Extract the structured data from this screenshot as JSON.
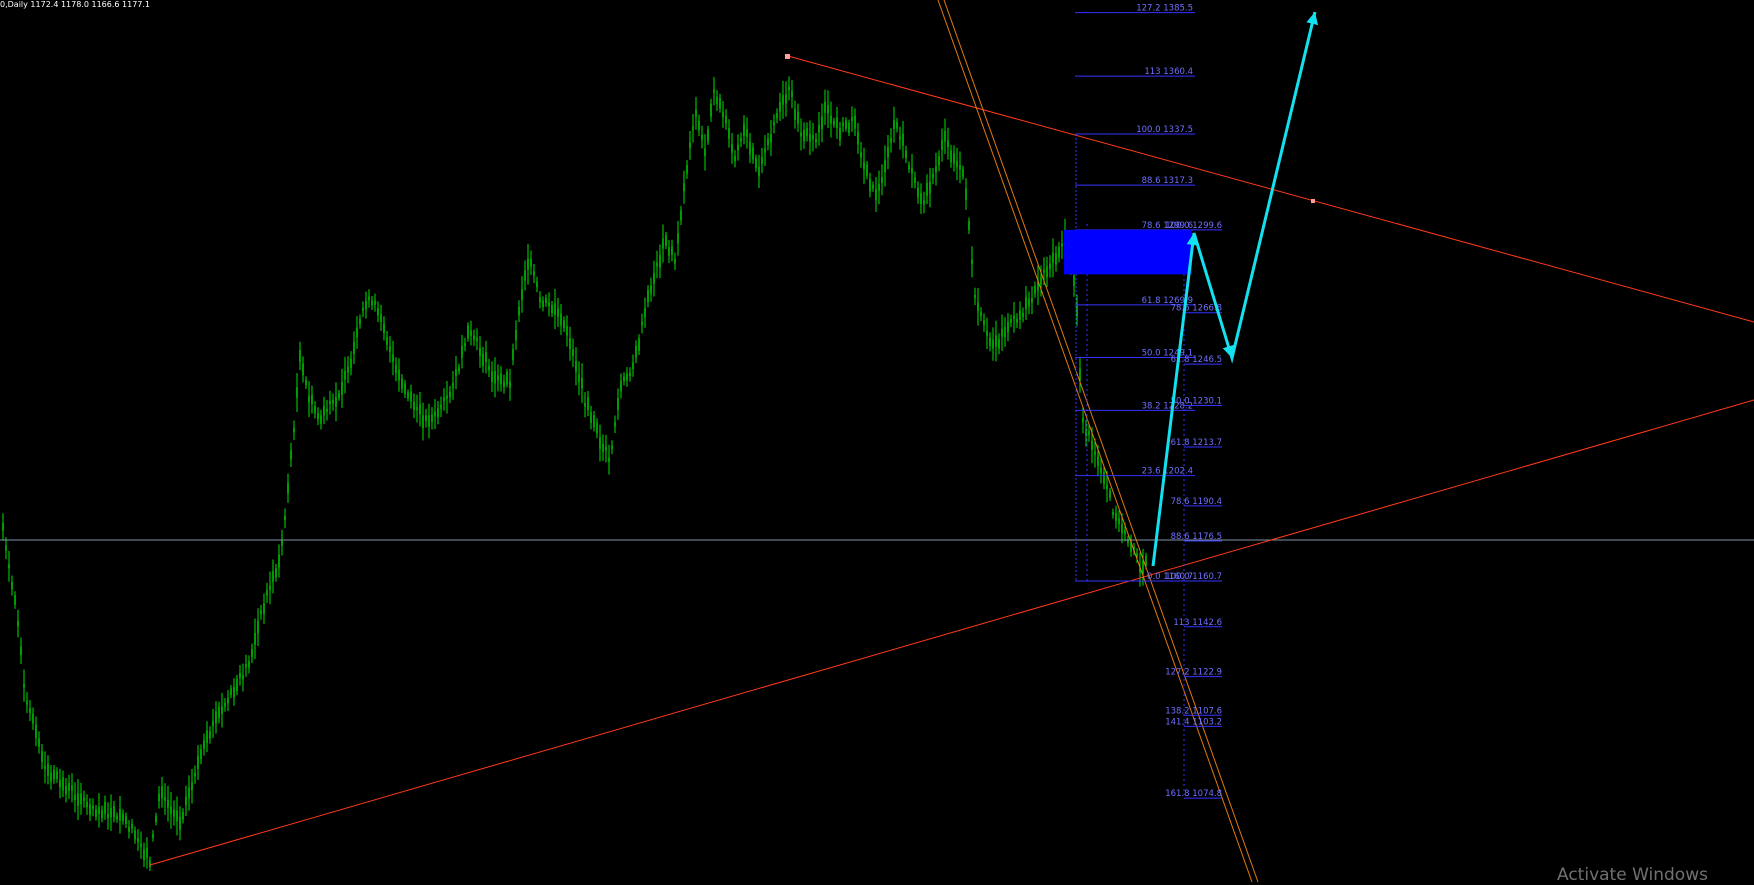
{
  "header": {
    "symbol_text": "0,Daily  1172.4 1178.0 1166.6 1177.1"
  },
  "watermark": "Activate Windows",
  "colors": {
    "background": "#000000",
    "candle": "#00e000",
    "fib_lines": "#3333ff",
    "fib_text": "#6f6fff",
    "trend_lines": "#ff3a1a",
    "channel_lines": "#e07a12",
    "horizontal_line": "#7f93a8",
    "projection_arrow": "#14e1f0",
    "target_zone": "#0000ff",
    "anchor_point": "#ff9d9d"
  },
  "price_scale": {
    "comment": "chart price axis (data units)",
    "top_price": 1392,
    "bottom_price": 1043
  },
  "fib_retracement": [
    {
      "label": "127.2 1385.5"
    },
    {
      "label": "113 1360.4"
    },
    {
      "label": "100.0 1337.5"
    },
    {
      "label": "88.6 1317.3"
    },
    {
      "label": "78.6 1299.6"
    },
    {
      "label": "61.8 1269.9"
    },
    {
      "label": "50.0 1249.1"
    },
    {
      "label": "38.2 1228.2"
    },
    {
      "label": "23.6 1202.4"
    },
    {
      "label": "0.0 1160.7"
    }
  ],
  "fib_extension": [
    {
      "label": "100.0 1299.6"
    },
    {
      "label": "78.6 1266.8"
    },
    {
      "label": "61.8 1246.5"
    },
    {
      "label": "50.0 1230.1"
    },
    {
      "label": "61.8 1213.7"
    },
    {
      "label": "78.6 1190.4"
    },
    {
      "label": "88.6 1176.5"
    },
    {
      "label": "100.0 1160.7"
    },
    {
      "label": "113 1142.6"
    },
    {
      "label": "127.2 1122.9"
    },
    {
      "label": "138.2 1107.6"
    },
    {
      "label": "141.4 1103.2"
    },
    {
      "label": "161.8 1074.8"
    }
  ]
}
